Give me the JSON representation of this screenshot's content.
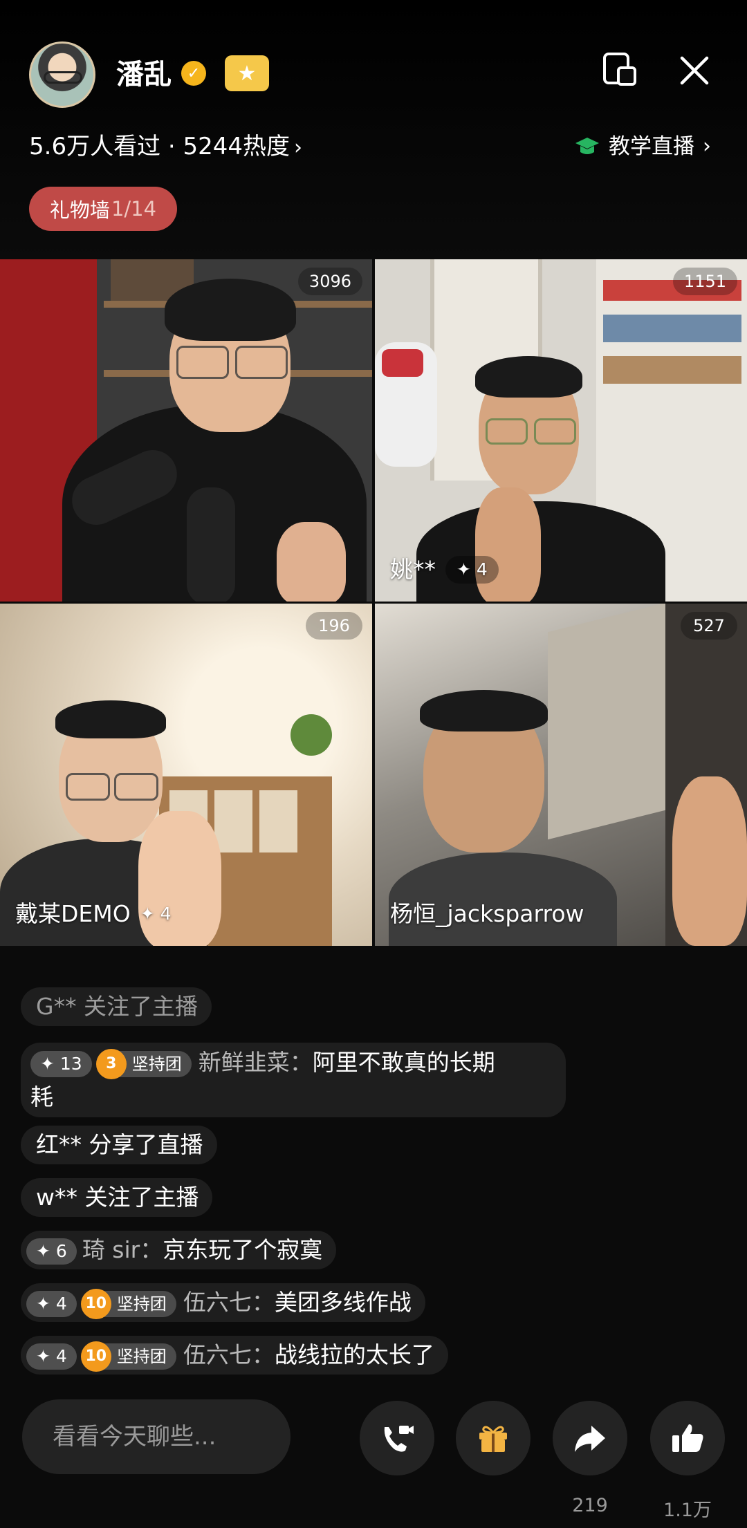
{
  "host": {
    "name": "潘乱",
    "stats": "5.6万人看过 · 5244热度",
    "category": "教学直播",
    "gift_wall_label": "礼物墙",
    "gift_wall_count": "1/14"
  },
  "tiles": [
    {
      "viewers": "3096",
      "name": "",
      "level": ""
    },
    {
      "viewers": "1151",
      "name": "姚**",
      "level": "✦ 4"
    },
    {
      "viewers": "196",
      "name": "戴某DEMO",
      "level": "✦ 4"
    },
    {
      "viewers": "527",
      "name": "杨恒_jacksparrow",
      "level": ""
    }
  ],
  "chat": [
    {
      "type": "system",
      "text": "G** 关注了主播"
    },
    {
      "type": "message",
      "level": "13",
      "team_rank": "3",
      "team_name": "坚持团",
      "user": "新鲜韭菜：",
      "text": "阿里不敢真的长期",
      "text2": "耗"
    },
    {
      "type": "system",
      "text": "红** 分享了直播"
    },
    {
      "type": "system",
      "text": "w** 关注了主播"
    },
    {
      "type": "message",
      "level": "✦ 6",
      "user": "琦 sir：",
      "text": "京东玩了个寂寞"
    },
    {
      "type": "message",
      "level": "✦ 4",
      "team_rank": "10",
      "team_name": "坚持团",
      "user": "伍六七：",
      "text": "美团多线作战"
    },
    {
      "type": "message",
      "level": "✦ 4",
      "team_rank": "10",
      "team_name": "坚持团",
      "user": "伍六七：",
      "text": "战线拉的太长了"
    }
  ],
  "bottom": {
    "input_placeholder": "看看今天聊些...",
    "share_count": "219",
    "like_count": "1.1万"
  },
  "colors": {
    "gift_wall": "#c04a47",
    "verified": "#f6b51c",
    "education_icon": "#27b561",
    "gift_icon": "#f3b443"
  }
}
